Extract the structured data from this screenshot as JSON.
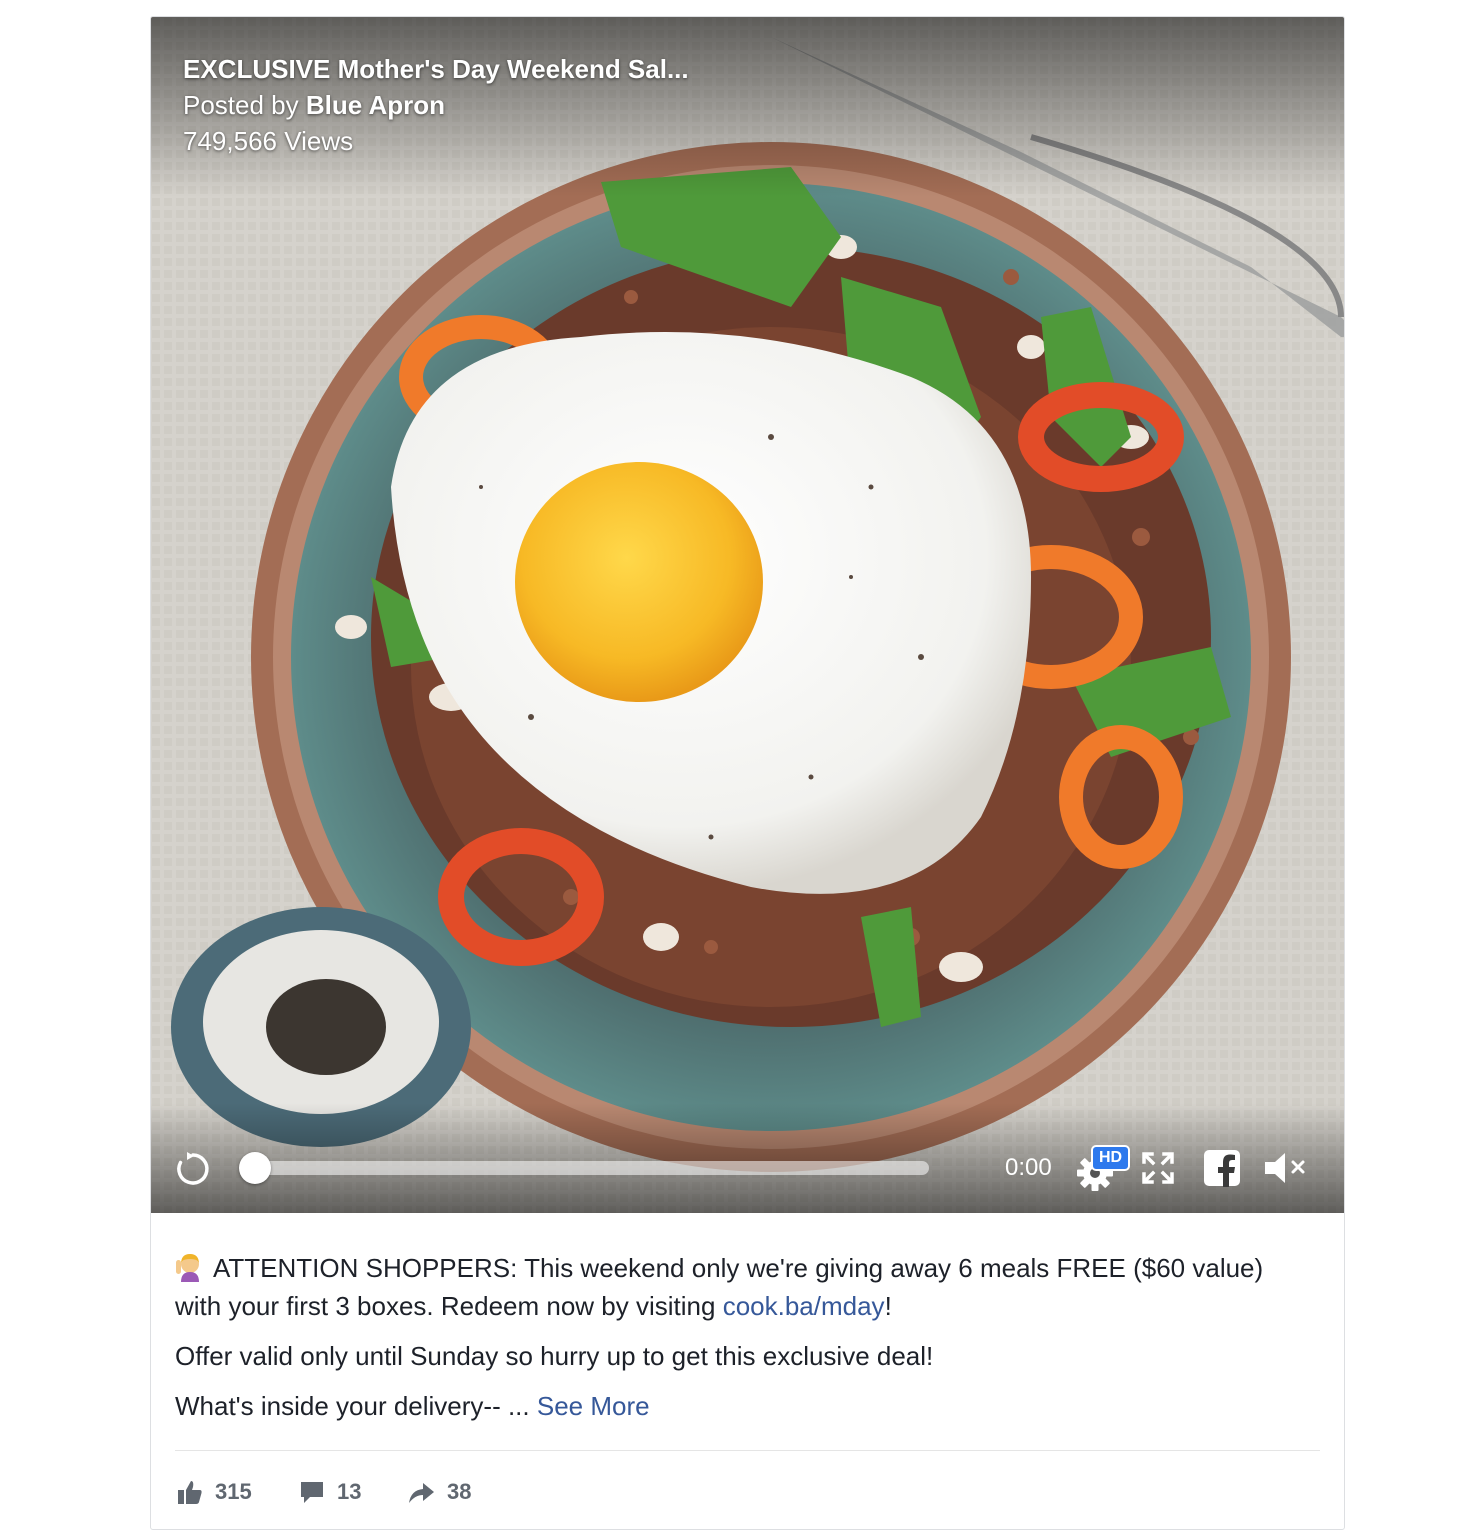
{
  "video": {
    "title": "EXCLUSIVE Mother's Day Weekend Sal...",
    "posted_prefix": "Posted by",
    "author": "Blue Apron",
    "views": "749,566 Views",
    "time": "0:00",
    "hd_label": "HD",
    "progress": 0.0,
    "icons": [
      "replay-icon",
      "settings-gear-icon",
      "fullscreen-icon",
      "facebook-icon",
      "mute-icon"
    ]
  },
  "post": {
    "line1_text": "ATTENTION SHOPPERS: This weekend only we're giving away 6 meals FREE ($60 value) with your first 3 boxes. Redeem now by visiting",
    "link_text": "cook.ba/mday",
    "line1_end": "!",
    "line2": "Offer valid only until Sunday so hurry up to get this exclusive deal!",
    "line3": "What's inside your delivery-- ...",
    "see_more": "See More",
    "emoji": "woman-raising-hand-emoji"
  },
  "reactions": {
    "likes": "315",
    "comments": "13",
    "shares": "38"
  },
  "colors": {
    "link": "#365899",
    "text": "#1d2129",
    "muted": "#606770",
    "hd_badge": "#2d79ed"
  }
}
